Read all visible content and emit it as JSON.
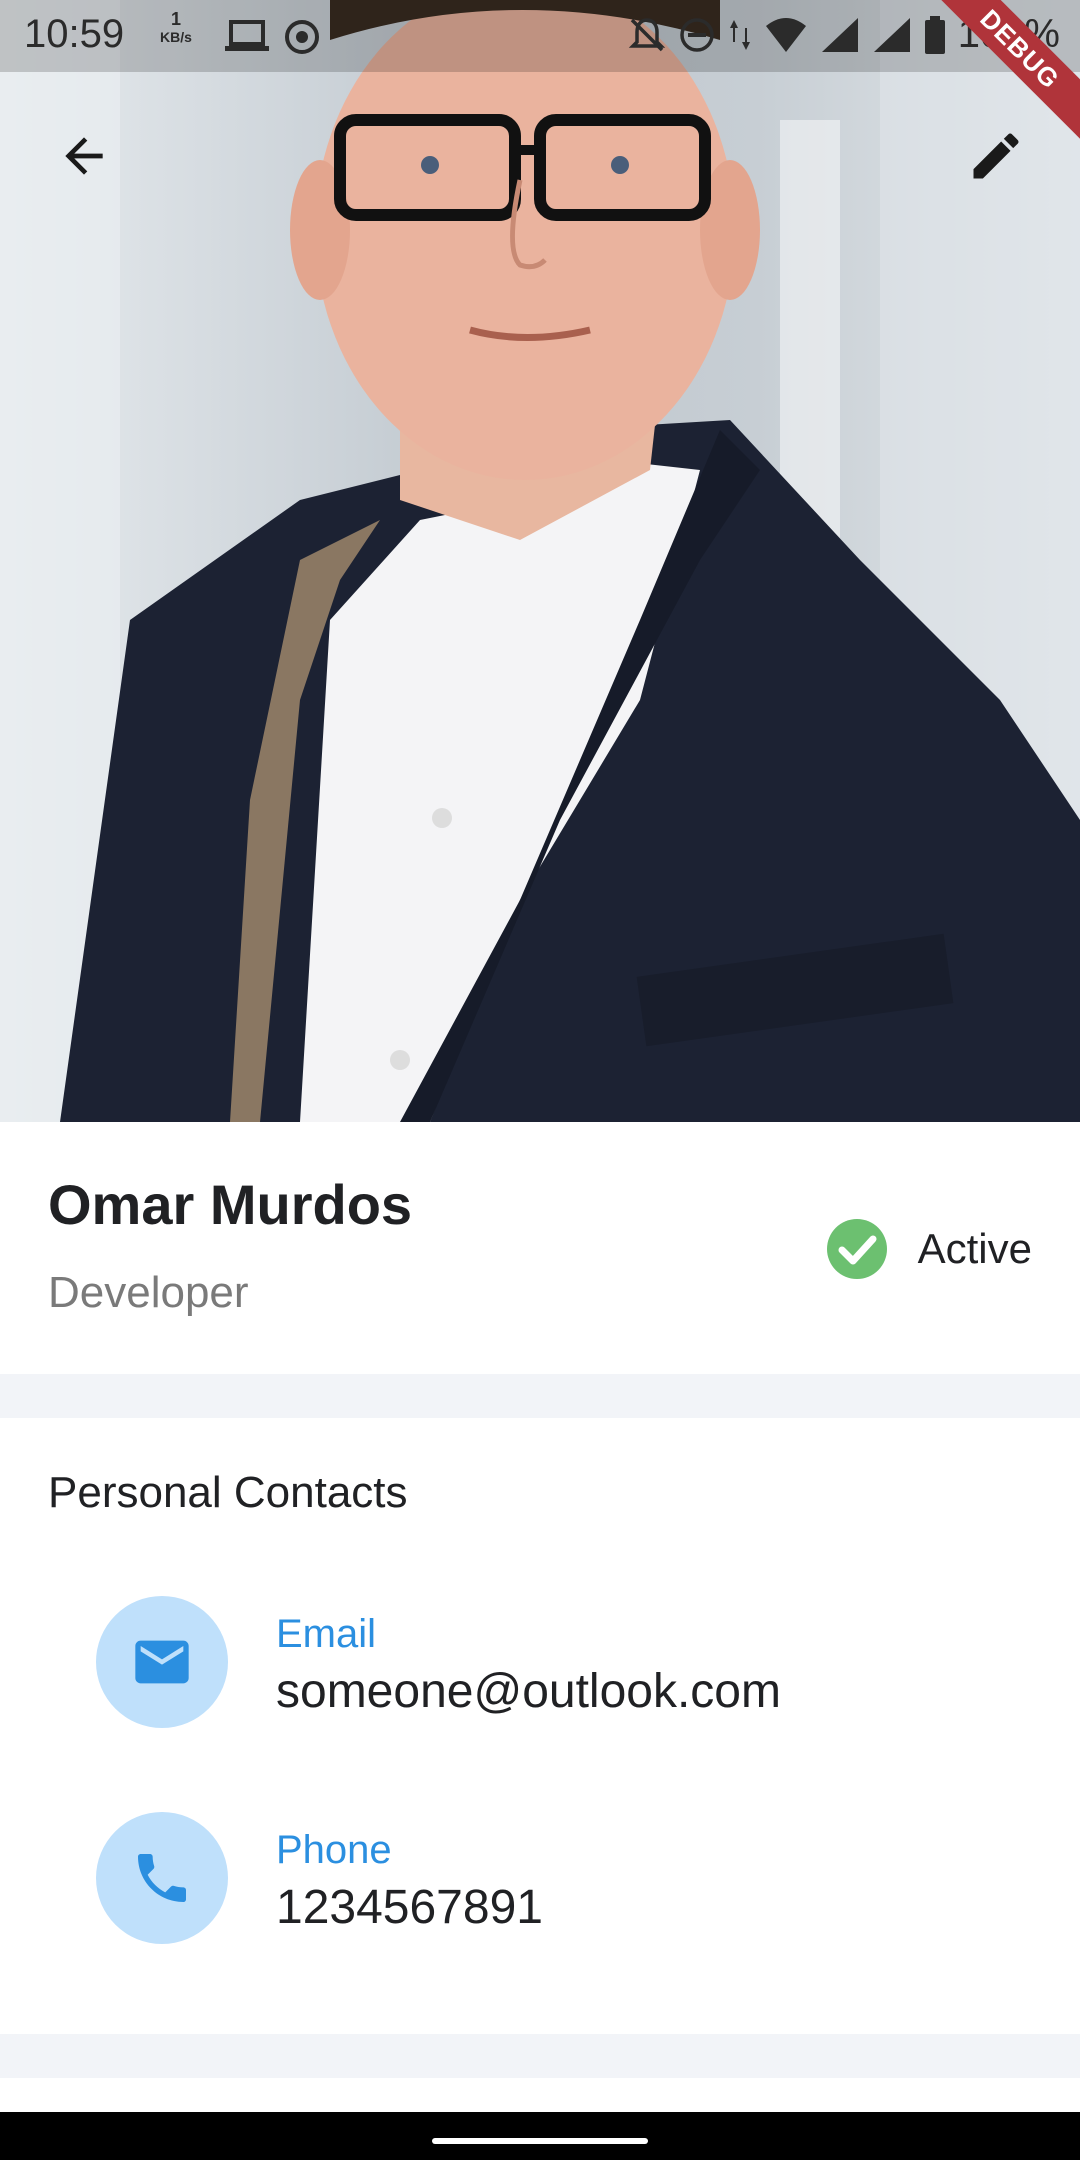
{
  "status_bar": {
    "time": "10:59",
    "speed_value": "1",
    "speed_unit": "KB/s",
    "battery": "100%"
  },
  "debug_label": "DEBUG",
  "profile": {
    "name": "Omar Murdos",
    "role": "Developer",
    "status": "Active",
    "status_color": "#6cc070"
  },
  "contacts": {
    "title": "Personal Contacts",
    "items": [
      {
        "icon": "email-icon",
        "label": "Email",
        "value": "someone@outlook.com"
      },
      {
        "icon": "phone-icon",
        "label": "Phone",
        "value": "1234567891"
      }
    ]
  },
  "colors": {
    "accent": "#2b8fe0",
    "icon_bg": "#bfe0fb",
    "divider": "#f2f4f8"
  }
}
